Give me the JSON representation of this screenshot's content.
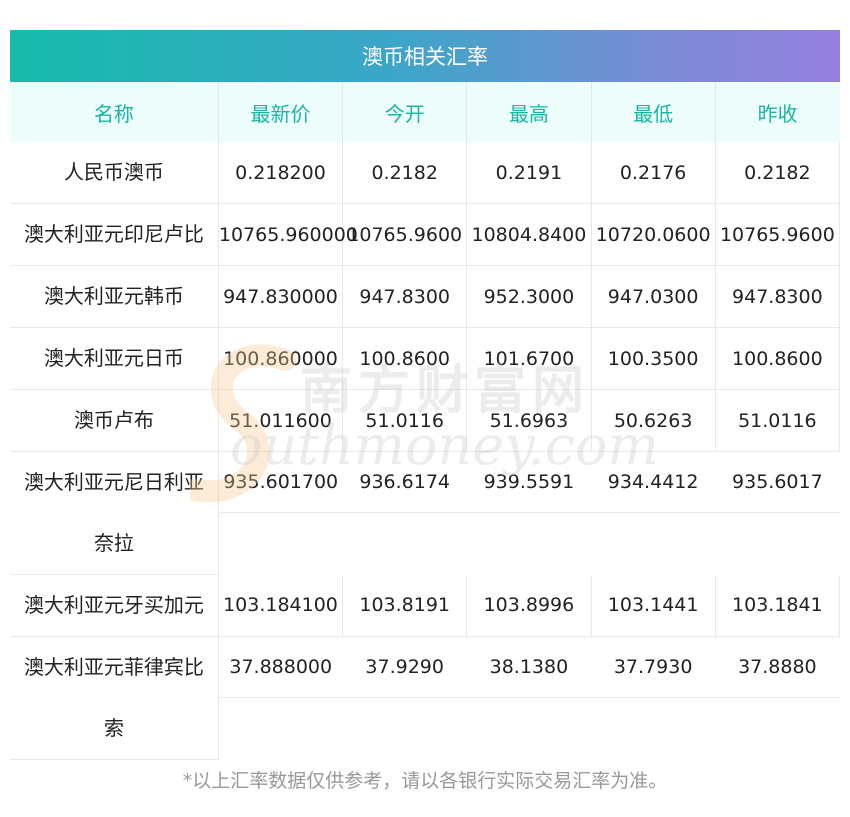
{
  "title": "澳币相关汇率",
  "columns": [
    "名称",
    "最新价",
    "今开",
    "最高",
    "最低",
    "昨收"
  ],
  "rows": [
    {
      "name": "人民币澳币",
      "latest": "0.218200",
      "open": "0.2182",
      "high": "0.2191",
      "low": "0.2176",
      "prev_close": "0.2182"
    },
    {
      "name": "澳大利亚元印尼卢比",
      "latest": "10765.960000",
      "open": "10765.9600",
      "high": "10804.8400",
      "low": "10720.0600",
      "prev_close": "10765.9600"
    },
    {
      "name": "澳大利亚元韩币",
      "latest": "947.830000",
      "open": "947.8300",
      "high": "952.3000",
      "low": "947.0300",
      "prev_close": "947.8300"
    },
    {
      "name": "澳大利亚元日币",
      "latest": "100.860000",
      "open": "100.8600",
      "high": "101.6700",
      "low": "100.3500",
      "prev_close": "100.8600"
    },
    {
      "name": "澳币卢布",
      "latest": "51.011600",
      "open": "51.0116",
      "high": "51.6963",
      "low": "50.6263",
      "prev_close": "51.0116"
    },
    {
      "name": "澳大利亚元尼日利亚",
      "name_cont": "奈拉",
      "latest": "935.601700",
      "open": "936.6174",
      "high": "939.5591",
      "low": "934.4412",
      "prev_close": "935.6017"
    },
    {
      "name": "澳大利亚元牙买加元",
      "latest": "103.184100",
      "open": "103.8191",
      "high": "103.8996",
      "low": "103.1441",
      "prev_close": "103.1841"
    },
    {
      "name": "澳大利亚元菲律宾比",
      "name_cont": "索",
      "latest": "37.888000",
      "open": "37.9290",
      "high": "38.1380",
      "low": "37.7930",
      "prev_close": "37.8880"
    }
  ],
  "watermark": {
    "cn": "南方财富网",
    "en": "outhmoney.com"
  },
  "footnote": "*以上汇率数据仅供参考，请以各银行实际交易汇率为准。",
  "colors": {
    "header_text": "#1bb3a4",
    "header_bg": "#ecfdfb",
    "gradient_start": "#16bbab",
    "gradient_end": "#9680e0",
    "footnote": "#999999"
  }
}
